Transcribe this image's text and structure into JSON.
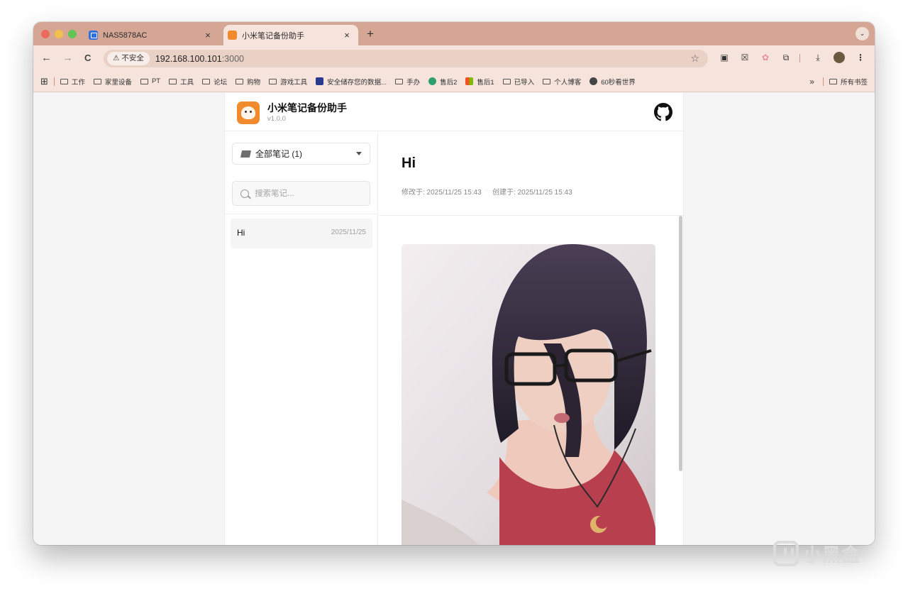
{
  "browser": {
    "tabs": [
      {
        "title": "NAS5878AC",
        "close": "×"
      },
      {
        "title": "小米笔记备份助手",
        "close": "×"
      }
    ],
    "new_tab": "+",
    "tab_search": "⌄",
    "nav": {
      "back": "←",
      "forward": "→",
      "reload": "C"
    },
    "security_badge": "⚠ 不安全",
    "url_host": "192.168.100.101",
    "url_port": ":3000",
    "bookmark_star": "☆",
    "bookmarks": [
      "工作",
      "家里设备",
      "PT",
      "工具",
      "论坛",
      "购物",
      "游戏工具",
      "安全储存您的数据...",
      "手办",
      "售后2",
      "售后1",
      "已导入",
      "个人博客",
      "60秒看世界"
    ],
    "bookmarks_overflow": "»",
    "all_bookmarks": "所有书签",
    "apps_glyph": "⊞",
    "menu": "⋮",
    "download_glyph": "⤓"
  },
  "app": {
    "title": "小米笔记备份助手",
    "version": "v1.0.0"
  },
  "sidebar": {
    "folder_select": "全部笔记 (1)",
    "search_placeholder": "搜索笔记...",
    "notes": [
      {
        "title": "Hi",
        "date": "2025/11/25"
      }
    ]
  },
  "note": {
    "title": "Hi",
    "modified": "修改于: 2025/11/25 15:43",
    "created": "创建于: 2025/11/25 15:43"
  },
  "watermark": "小黑盒",
  "colors": {
    "tabstrip": "#d5a693",
    "toolbar": "#f6e4dc",
    "logo": "#f08a2c"
  }
}
